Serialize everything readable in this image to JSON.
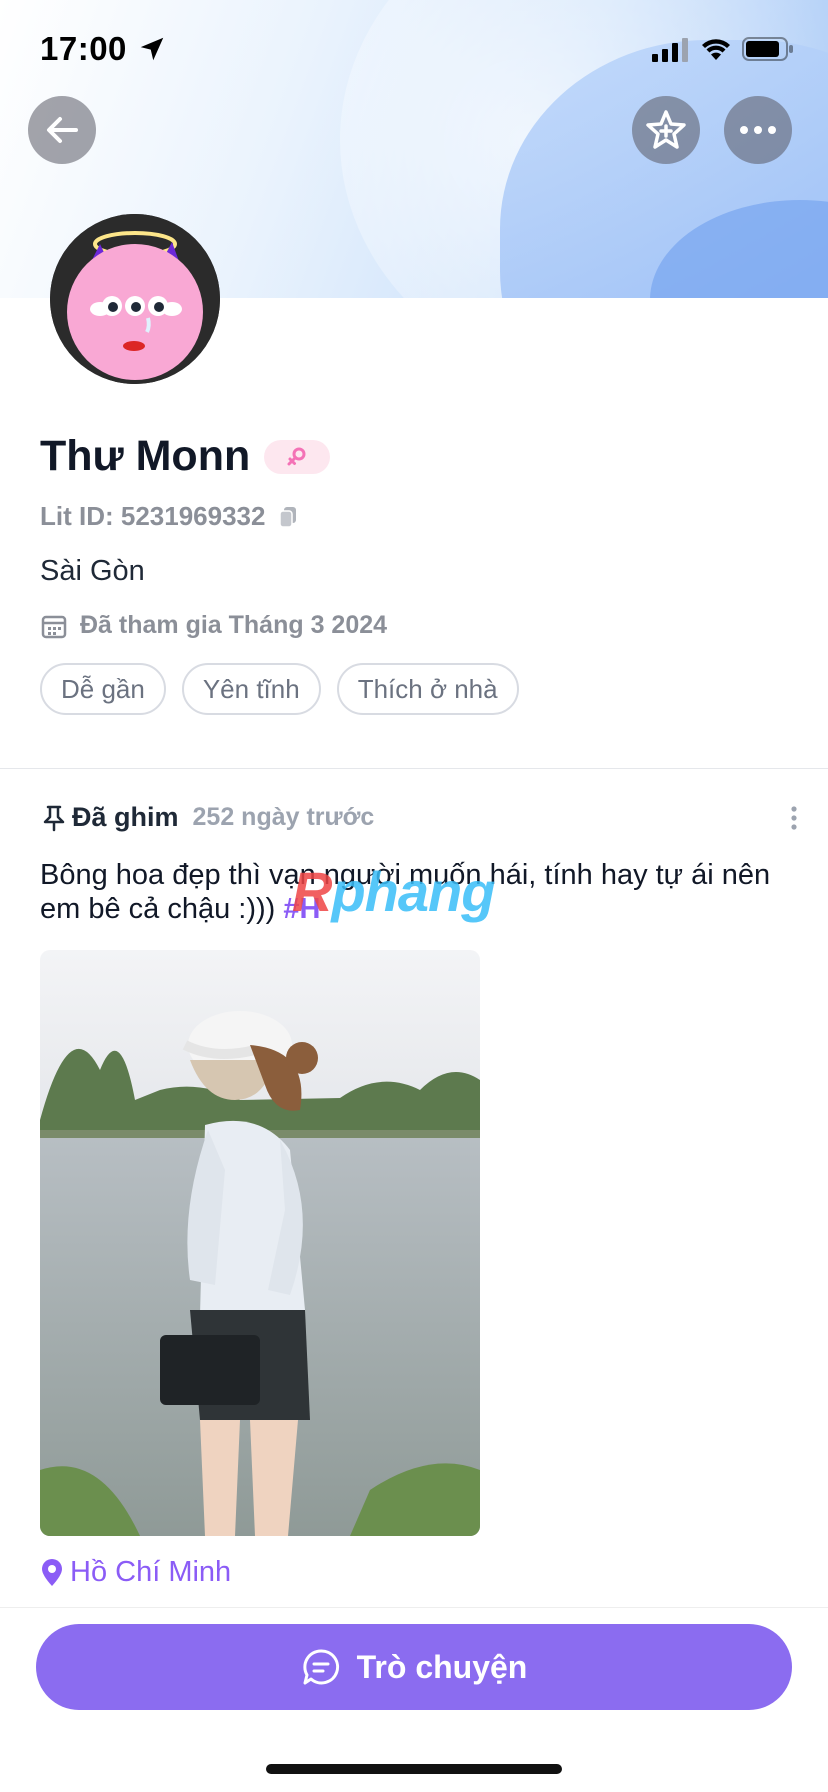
{
  "status_bar": {
    "time": "17:00",
    "icons": [
      "location-arrow-icon",
      "cellular-signal-icon",
      "wifi-icon",
      "battery-icon"
    ]
  },
  "nav": {
    "back_icon": "arrow-left-icon",
    "favorite_icon": "star-add-icon",
    "more_icon": "ellipsis-icon"
  },
  "profile": {
    "name": "Thư Monn",
    "gender_icon": "female-icon",
    "lit_id": "Lit ID: 5231969332",
    "copy_icon": "copy-icon",
    "city": "Sài Gòn",
    "calendar_icon": "calendar-icon",
    "joined": "Đã tham gia Tháng 3 2024",
    "tags": [
      "Dễ gần",
      "Yên tĩnh",
      "Thích ở nhà"
    ]
  },
  "post": {
    "pin_icon": "pin-icon",
    "pin_label": "Đã ghim",
    "time_ago": "252 ngày trước",
    "menu_icon": "vertical-ellipsis-icon",
    "text": "Bông hoa đẹp thì vạn người muốn hái, tính hay tự ái nên em bê cả chậu :))) ",
    "hashtag": "#H",
    "location_icon": "map-pin-icon",
    "location": "Hồ Chí Minh"
  },
  "watermark": {
    "first": "R",
    "rest": "phang"
  },
  "chat_button": {
    "label": "Trò chuyện",
    "icon": "chat-bubble-icon"
  },
  "colors": {
    "accent": "#8b6cf0",
    "hashtag": "#8b5cf6",
    "muted_text": "#8b8f98",
    "female_badge_bg": "#fde7ef",
    "female_icon": "#f472b6"
  }
}
